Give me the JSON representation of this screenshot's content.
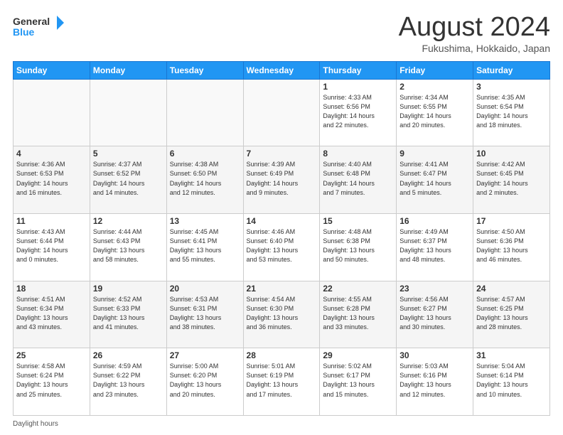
{
  "header": {
    "logo_line1": "General",
    "logo_line2": "Blue",
    "month_title": "August 2024",
    "location": "Fukushima, Hokkaido, Japan"
  },
  "days_of_week": [
    "Sunday",
    "Monday",
    "Tuesday",
    "Wednesday",
    "Thursday",
    "Friday",
    "Saturday"
  ],
  "weeks": [
    [
      {
        "day": "",
        "info": ""
      },
      {
        "day": "",
        "info": ""
      },
      {
        "day": "",
        "info": ""
      },
      {
        "day": "",
        "info": ""
      },
      {
        "day": "1",
        "info": "Sunrise: 4:33 AM\nSunset: 6:56 PM\nDaylight: 14 hours\nand 22 minutes."
      },
      {
        "day": "2",
        "info": "Sunrise: 4:34 AM\nSunset: 6:55 PM\nDaylight: 14 hours\nand 20 minutes."
      },
      {
        "day": "3",
        "info": "Sunrise: 4:35 AM\nSunset: 6:54 PM\nDaylight: 14 hours\nand 18 minutes."
      }
    ],
    [
      {
        "day": "4",
        "info": "Sunrise: 4:36 AM\nSunset: 6:53 PM\nDaylight: 14 hours\nand 16 minutes."
      },
      {
        "day": "5",
        "info": "Sunrise: 4:37 AM\nSunset: 6:52 PM\nDaylight: 14 hours\nand 14 minutes."
      },
      {
        "day": "6",
        "info": "Sunrise: 4:38 AM\nSunset: 6:50 PM\nDaylight: 14 hours\nand 12 minutes."
      },
      {
        "day": "7",
        "info": "Sunrise: 4:39 AM\nSunset: 6:49 PM\nDaylight: 14 hours\nand 9 minutes."
      },
      {
        "day": "8",
        "info": "Sunrise: 4:40 AM\nSunset: 6:48 PM\nDaylight: 14 hours\nand 7 minutes."
      },
      {
        "day": "9",
        "info": "Sunrise: 4:41 AM\nSunset: 6:47 PM\nDaylight: 14 hours\nand 5 minutes."
      },
      {
        "day": "10",
        "info": "Sunrise: 4:42 AM\nSunset: 6:45 PM\nDaylight: 14 hours\nand 2 minutes."
      }
    ],
    [
      {
        "day": "11",
        "info": "Sunrise: 4:43 AM\nSunset: 6:44 PM\nDaylight: 14 hours\nand 0 minutes."
      },
      {
        "day": "12",
        "info": "Sunrise: 4:44 AM\nSunset: 6:43 PM\nDaylight: 13 hours\nand 58 minutes."
      },
      {
        "day": "13",
        "info": "Sunrise: 4:45 AM\nSunset: 6:41 PM\nDaylight: 13 hours\nand 55 minutes."
      },
      {
        "day": "14",
        "info": "Sunrise: 4:46 AM\nSunset: 6:40 PM\nDaylight: 13 hours\nand 53 minutes."
      },
      {
        "day": "15",
        "info": "Sunrise: 4:48 AM\nSunset: 6:38 PM\nDaylight: 13 hours\nand 50 minutes."
      },
      {
        "day": "16",
        "info": "Sunrise: 4:49 AM\nSunset: 6:37 PM\nDaylight: 13 hours\nand 48 minutes."
      },
      {
        "day": "17",
        "info": "Sunrise: 4:50 AM\nSunset: 6:36 PM\nDaylight: 13 hours\nand 46 minutes."
      }
    ],
    [
      {
        "day": "18",
        "info": "Sunrise: 4:51 AM\nSunset: 6:34 PM\nDaylight: 13 hours\nand 43 minutes."
      },
      {
        "day": "19",
        "info": "Sunrise: 4:52 AM\nSunset: 6:33 PM\nDaylight: 13 hours\nand 41 minutes."
      },
      {
        "day": "20",
        "info": "Sunrise: 4:53 AM\nSunset: 6:31 PM\nDaylight: 13 hours\nand 38 minutes."
      },
      {
        "day": "21",
        "info": "Sunrise: 4:54 AM\nSunset: 6:30 PM\nDaylight: 13 hours\nand 36 minutes."
      },
      {
        "day": "22",
        "info": "Sunrise: 4:55 AM\nSunset: 6:28 PM\nDaylight: 13 hours\nand 33 minutes."
      },
      {
        "day": "23",
        "info": "Sunrise: 4:56 AM\nSunset: 6:27 PM\nDaylight: 13 hours\nand 30 minutes."
      },
      {
        "day": "24",
        "info": "Sunrise: 4:57 AM\nSunset: 6:25 PM\nDaylight: 13 hours\nand 28 minutes."
      }
    ],
    [
      {
        "day": "25",
        "info": "Sunrise: 4:58 AM\nSunset: 6:24 PM\nDaylight: 13 hours\nand 25 minutes."
      },
      {
        "day": "26",
        "info": "Sunrise: 4:59 AM\nSunset: 6:22 PM\nDaylight: 13 hours\nand 23 minutes."
      },
      {
        "day": "27",
        "info": "Sunrise: 5:00 AM\nSunset: 6:20 PM\nDaylight: 13 hours\nand 20 minutes."
      },
      {
        "day": "28",
        "info": "Sunrise: 5:01 AM\nSunset: 6:19 PM\nDaylight: 13 hours\nand 17 minutes."
      },
      {
        "day": "29",
        "info": "Sunrise: 5:02 AM\nSunset: 6:17 PM\nDaylight: 13 hours\nand 15 minutes."
      },
      {
        "day": "30",
        "info": "Sunrise: 5:03 AM\nSunset: 6:16 PM\nDaylight: 13 hours\nand 12 minutes."
      },
      {
        "day": "31",
        "info": "Sunrise: 5:04 AM\nSunset: 6:14 PM\nDaylight: 13 hours\nand 10 minutes."
      }
    ]
  ],
  "footer": {
    "daylight_label": "Daylight hours"
  }
}
